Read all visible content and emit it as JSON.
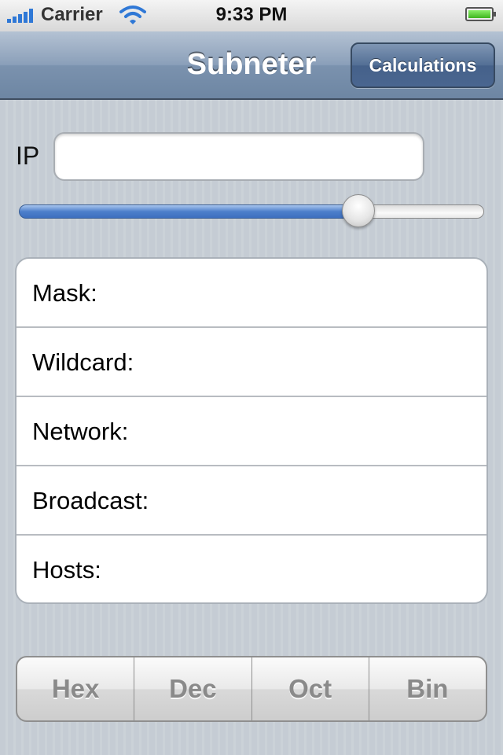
{
  "status_bar": {
    "carrier": "Carrier",
    "time": "9:33 PM"
  },
  "nav": {
    "title": "Subneter",
    "right_button": "Calculations"
  },
  "ip": {
    "label": "IP",
    "value": "",
    "placeholder": ""
  },
  "slider": {
    "value_fraction": 0.73
  },
  "results": [
    {
      "label": "Mask:"
    },
    {
      "label": "Wildcard:"
    },
    {
      "label": "Network:"
    },
    {
      "label": "Broadcast:"
    },
    {
      "label": "Hosts:"
    }
  ],
  "segments": [
    "Hex",
    "Dec",
    "Oct",
    "Bin"
  ],
  "colors": {
    "nav_tint": "#6d86a3",
    "slider_fill": "#4d7fcb",
    "background": "#c5ccd4"
  }
}
